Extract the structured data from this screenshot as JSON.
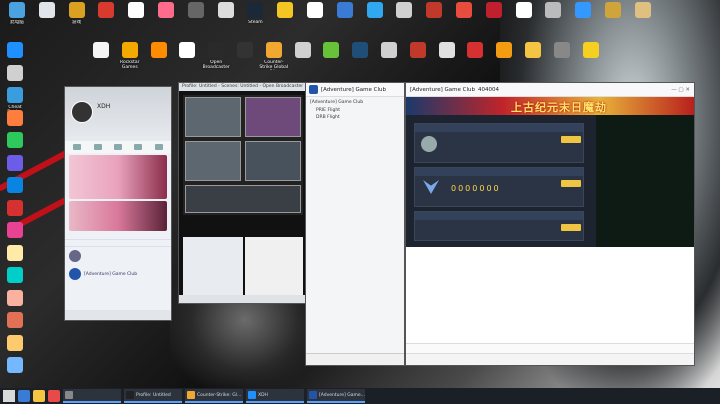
{
  "desktop": {
    "icons": [
      {
        "label": "此电脑",
        "color": "#4aa3e0"
      },
      {
        "label": "",
        "color": "#dfe5ea"
      },
      {
        "label": "游戏",
        "color": "#d9a022"
      },
      {
        "label": "",
        "color": "#d93a2e"
      },
      {
        "label": "",
        "color": "#ffffff"
      },
      {
        "label": "",
        "color": "#ff6b8a"
      },
      {
        "label": "",
        "color": "#666666"
      },
      {
        "label": "",
        "color": "#dddddd"
      },
      {
        "label": "Steam",
        "color": "#1b2838"
      },
      {
        "label": "",
        "color": "#f3c623"
      },
      {
        "label": "",
        "color": "#ffffff"
      },
      {
        "label": "",
        "color": "#3a7bd5"
      },
      {
        "label": "",
        "color": "#2fa8f0"
      },
      {
        "label": "",
        "color": "#d0d0d0"
      },
      {
        "label": "",
        "color": "#c0392b"
      },
      {
        "label": "",
        "color": "#e74c3c"
      },
      {
        "label": "",
        "color": "#c0202e"
      },
      {
        "label": "",
        "color": "#ffffff"
      },
      {
        "label": "",
        "color": "#bbbbbb"
      },
      {
        "label": "",
        "color": "#3399ff"
      },
      {
        "label": "",
        "color": "#cfa43a"
      },
      {
        "label": "",
        "color": "#e0c080"
      }
    ],
    "row2": [
      {
        "label": "",
        "color": "#f5f5f5"
      },
      {
        "label": "Rockstar Games",
        "color": "#f2a900"
      },
      {
        "label": "",
        "color": "#ff8c00"
      },
      {
        "label": "",
        "color": "#ffffff"
      },
      {
        "label": "Open Broadcaster",
        "color": "#2a2a2a"
      },
      {
        "label": "",
        "color": "#333333"
      },
      {
        "label": "Counter-Strike Global Of...",
        "color": "#f0a830"
      },
      {
        "label": "",
        "color": "#d0d0d0"
      },
      {
        "label": "",
        "color": "#67c23a"
      },
      {
        "label": "",
        "color": "#1f4e79"
      },
      {
        "label": "",
        "color": "#d0d0d0"
      },
      {
        "label": "",
        "color": "#c0392b"
      },
      {
        "label": "",
        "color": "#e0e0e0"
      },
      {
        "label": "",
        "color": "#d63031"
      },
      {
        "label": "",
        "color": "#f39c12"
      },
      {
        "label": "",
        "color": "#f4c542"
      },
      {
        "label": "",
        "color": "#888888"
      },
      {
        "label": "",
        "color": "#f5d020"
      }
    ],
    "left_col": [
      {
        "label": "",
        "color": "#1e90ff"
      },
      {
        "label": "",
        "color": "#d0d0d0"
      },
      {
        "label": "Cheat Engine",
        "color": "#3b9ddd"
      },
      {
        "label": "",
        "color": "#ff7e3d"
      },
      {
        "label": "",
        "color": "#2ec95c"
      },
      {
        "label": "",
        "color": "#6c5ce7"
      },
      {
        "label": "",
        "color": "#0984e3"
      },
      {
        "label": "",
        "color": "#d63031"
      },
      {
        "label": "",
        "color": "#e84393"
      },
      {
        "label": "",
        "color": "#ffeaa7"
      },
      {
        "label": "",
        "color": "#00cec9"
      },
      {
        "label": "",
        "color": "#fab1a0"
      },
      {
        "label": "",
        "color": "#e17055"
      },
      {
        "label": "",
        "color": "#fdcb6e"
      },
      {
        "label": "",
        "color": "#74b9ff"
      }
    ]
  },
  "qq": {
    "nickname": "XDH",
    "status": "",
    "list": [
      "",
      "",
      "",
      "",
      ""
    ],
    "contacts": [
      {
        "name": "",
        "msg": ""
      },
      {
        "name": "[Adventure] Game Club",
        "msg": ""
      }
    ]
  },
  "obs": {
    "title": "Profile: Untitled - Scenes: Untitled - Open Broadcaster",
    "status": ""
  },
  "club": {
    "title": "[Adventure] Game Club",
    "tree": [
      "",
      "[Adventure] Game Club",
      "PRIE Flight",
      "DRB Flight",
      "",
      "",
      "",
      "",
      "",
      "",
      "",
      "",
      "",
      "",
      "",
      "",
      "",
      "",
      "",
      "",
      "",
      "",
      "",
      "",
      "",
      "",
      "",
      "",
      "",
      "",
      "",
      "",
      "",
      "",
      "",
      ""
    ]
  },
  "chat": {
    "title": "[Adventure] Game Club",
    "id": "404004",
    "banner_text": "上古纪元末日魔劫",
    "panel1": "",
    "panel2": "",
    "panel3": "",
    "btn": "",
    "counter": "0000000",
    "game_lines": [
      "",
      "",
      "",
      "",
      "",
      "",
      "",
      "",
      "",
      "",
      "",
      "",
      ""
    ],
    "messages": [
      "",
      "",
      "",
      "",
      "",
      "",
      "",
      "",
      "",
      "",
      "",
      ""
    ],
    "toolbar": [
      "",
      "",
      "",
      ""
    ]
  },
  "taskbar": {
    "apps": [
      {
        "label": "",
        "color": "#888"
      },
      {
        "label": "Profile: Untitled",
        "color": "#222"
      },
      {
        "label": "Counter-Strike: Gl...",
        "color": "#f0a830"
      },
      {
        "label": "XDH",
        "color": "#1e90ff"
      },
      {
        "label": "[Adventure] Game...",
        "color": "#2255aa"
      }
    ],
    "time": "",
    "date": ""
  }
}
